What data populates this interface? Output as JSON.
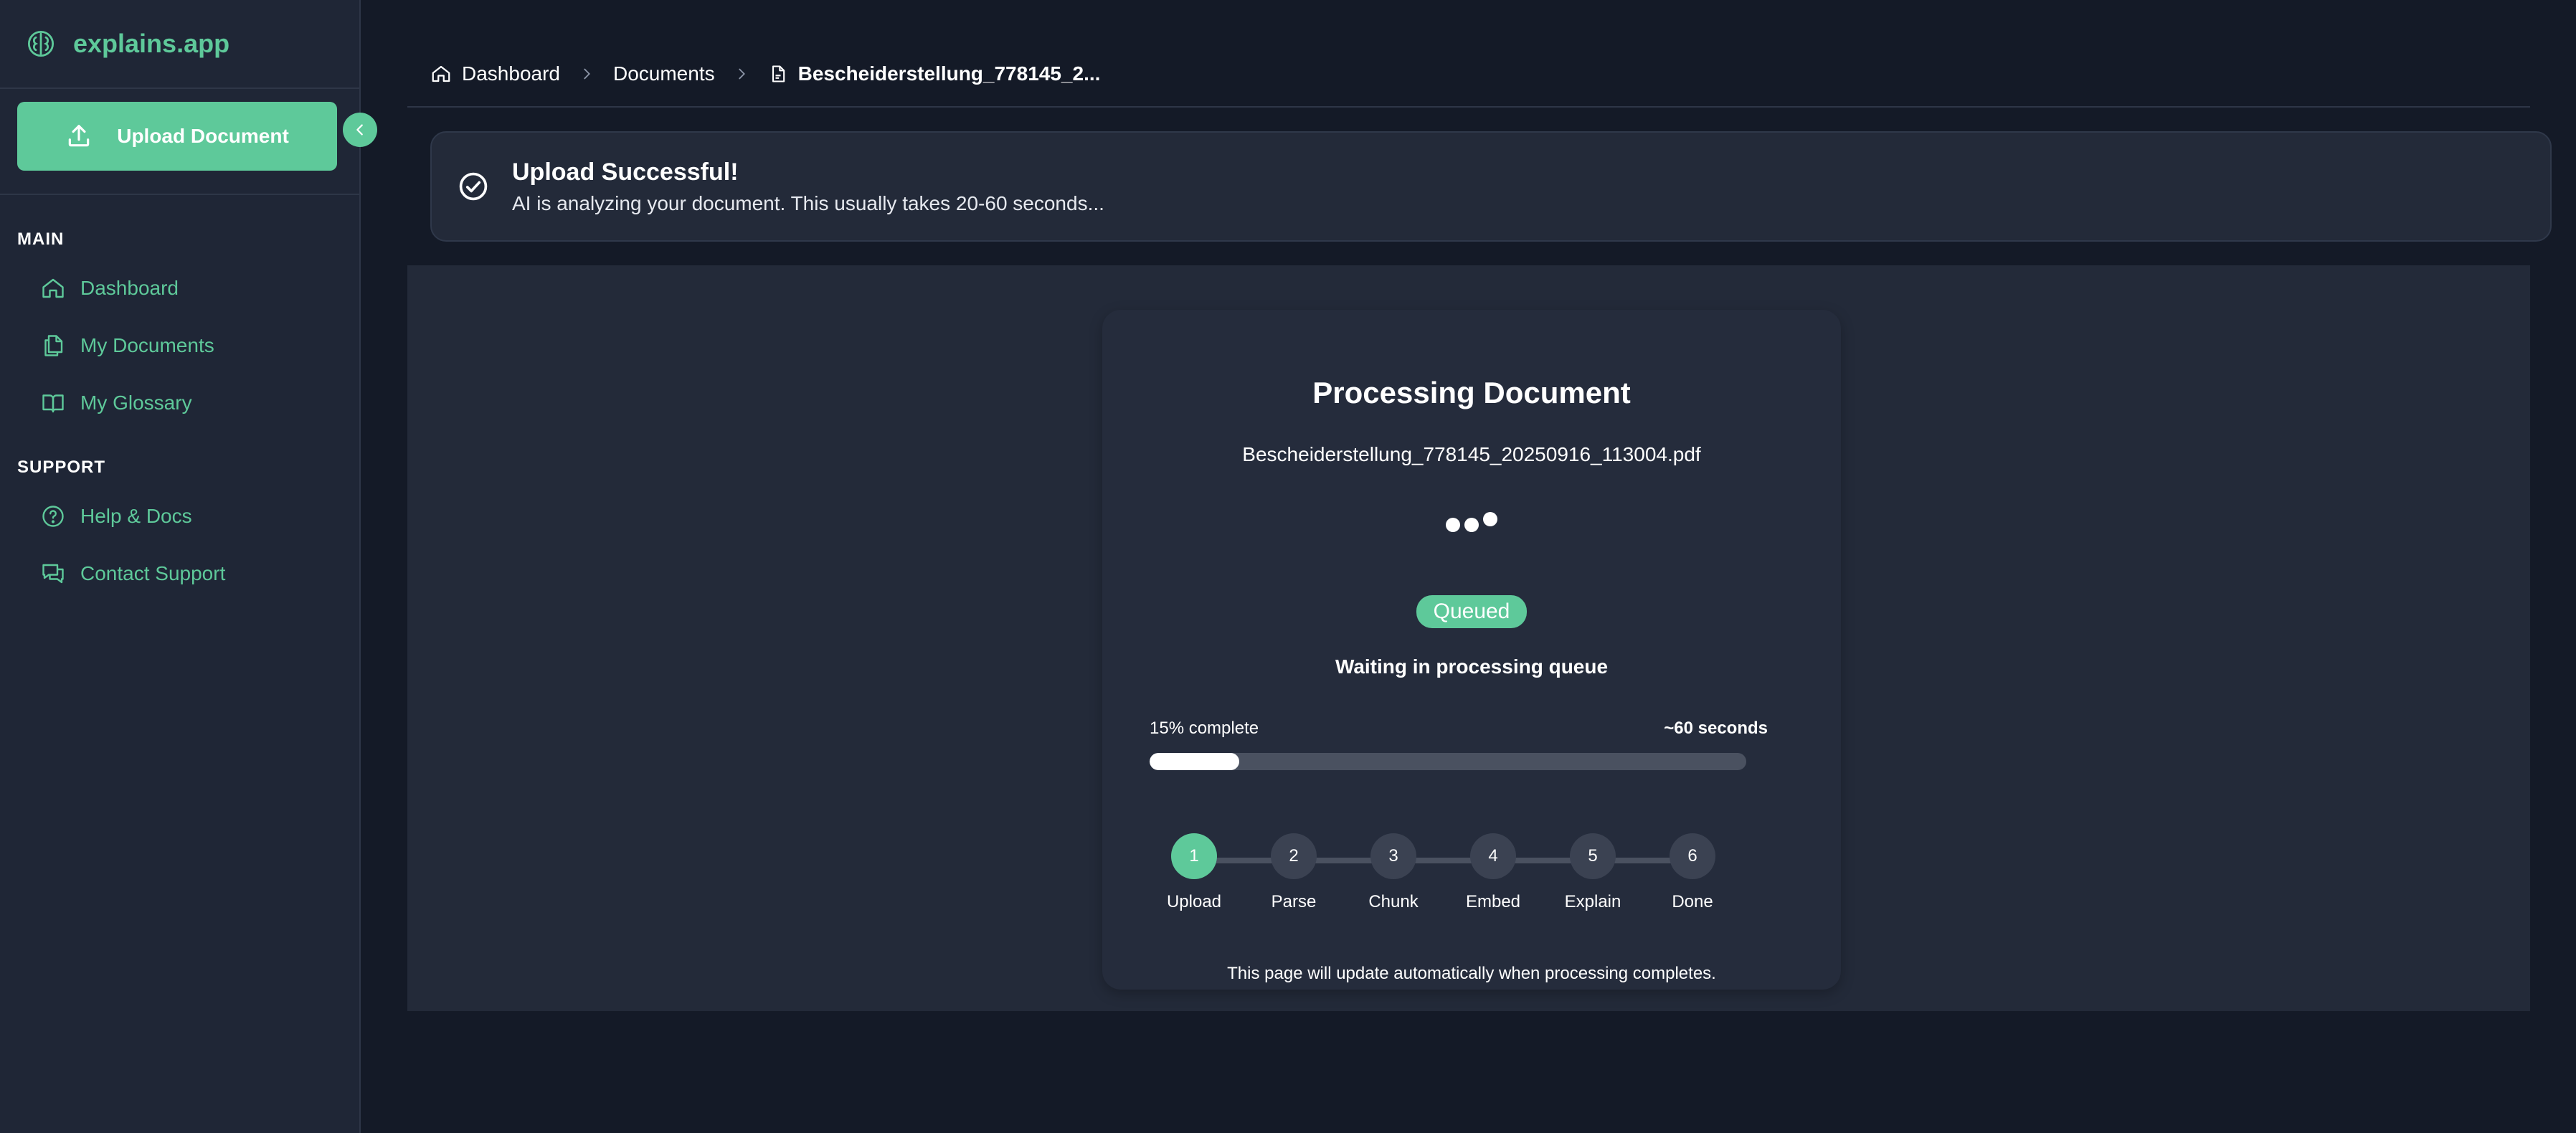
{
  "sidebar": {
    "brand": "explains.app",
    "upload_label": "Upload Document",
    "sections": [
      {
        "title": "MAIN",
        "items": [
          {
            "label": "Dashboard",
            "icon": "home-icon"
          },
          {
            "label": "My Documents",
            "icon": "documents-icon"
          },
          {
            "label": "My Glossary",
            "icon": "book-icon"
          }
        ]
      },
      {
        "title": "SUPPORT",
        "items": [
          {
            "label": "Help & Docs",
            "icon": "help-icon"
          },
          {
            "label": "Contact Support",
            "icon": "chat-icon"
          }
        ]
      }
    ]
  },
  "breadcrumb": {
    "items": [
      "Dashboard",
      "Documents"
    ],
    "current": "Bescheiderstellung_778145_2..."
  },
  "alert": {
    "title": "Upload Successful!",
    "message": "AI is analyzing your document. This usually takes 20-60 seconds..."
  },
  "processing": {
    "title": "Processing Document",
    "filename": "Bescheiderstellung_778145_20250916_113004.pdf",
    "badge": "Queued",
    "status": "Waiting in processing queue",
    "progress_label": "15% complete",
    "progress_percent": 15,
    "eta": "~60 seconds",
    "steps": [
      {
        "num": "1",
        "label": "Upload"
      },
      {
        "num": "2",
        "label": "Parse"
      },
      {
        "num": "3",
        "label": "Chunk"
      },
      {
        "num": "4",
        "label": "Embed"
      },
      {
        "num": "5",
        "label": "Explain"
      },
      {
        "num": "6",
        "label": "Done"
      }
    ],
    "active_step": 1,
    "note": "This page will update automatically when processing completes."
  },
  "colors": {
    "accent": "#5ec99a",
    "background": "#141a27",
    "sidebar": "#1f2636",
    "panel": "#232a39"
  }
}
